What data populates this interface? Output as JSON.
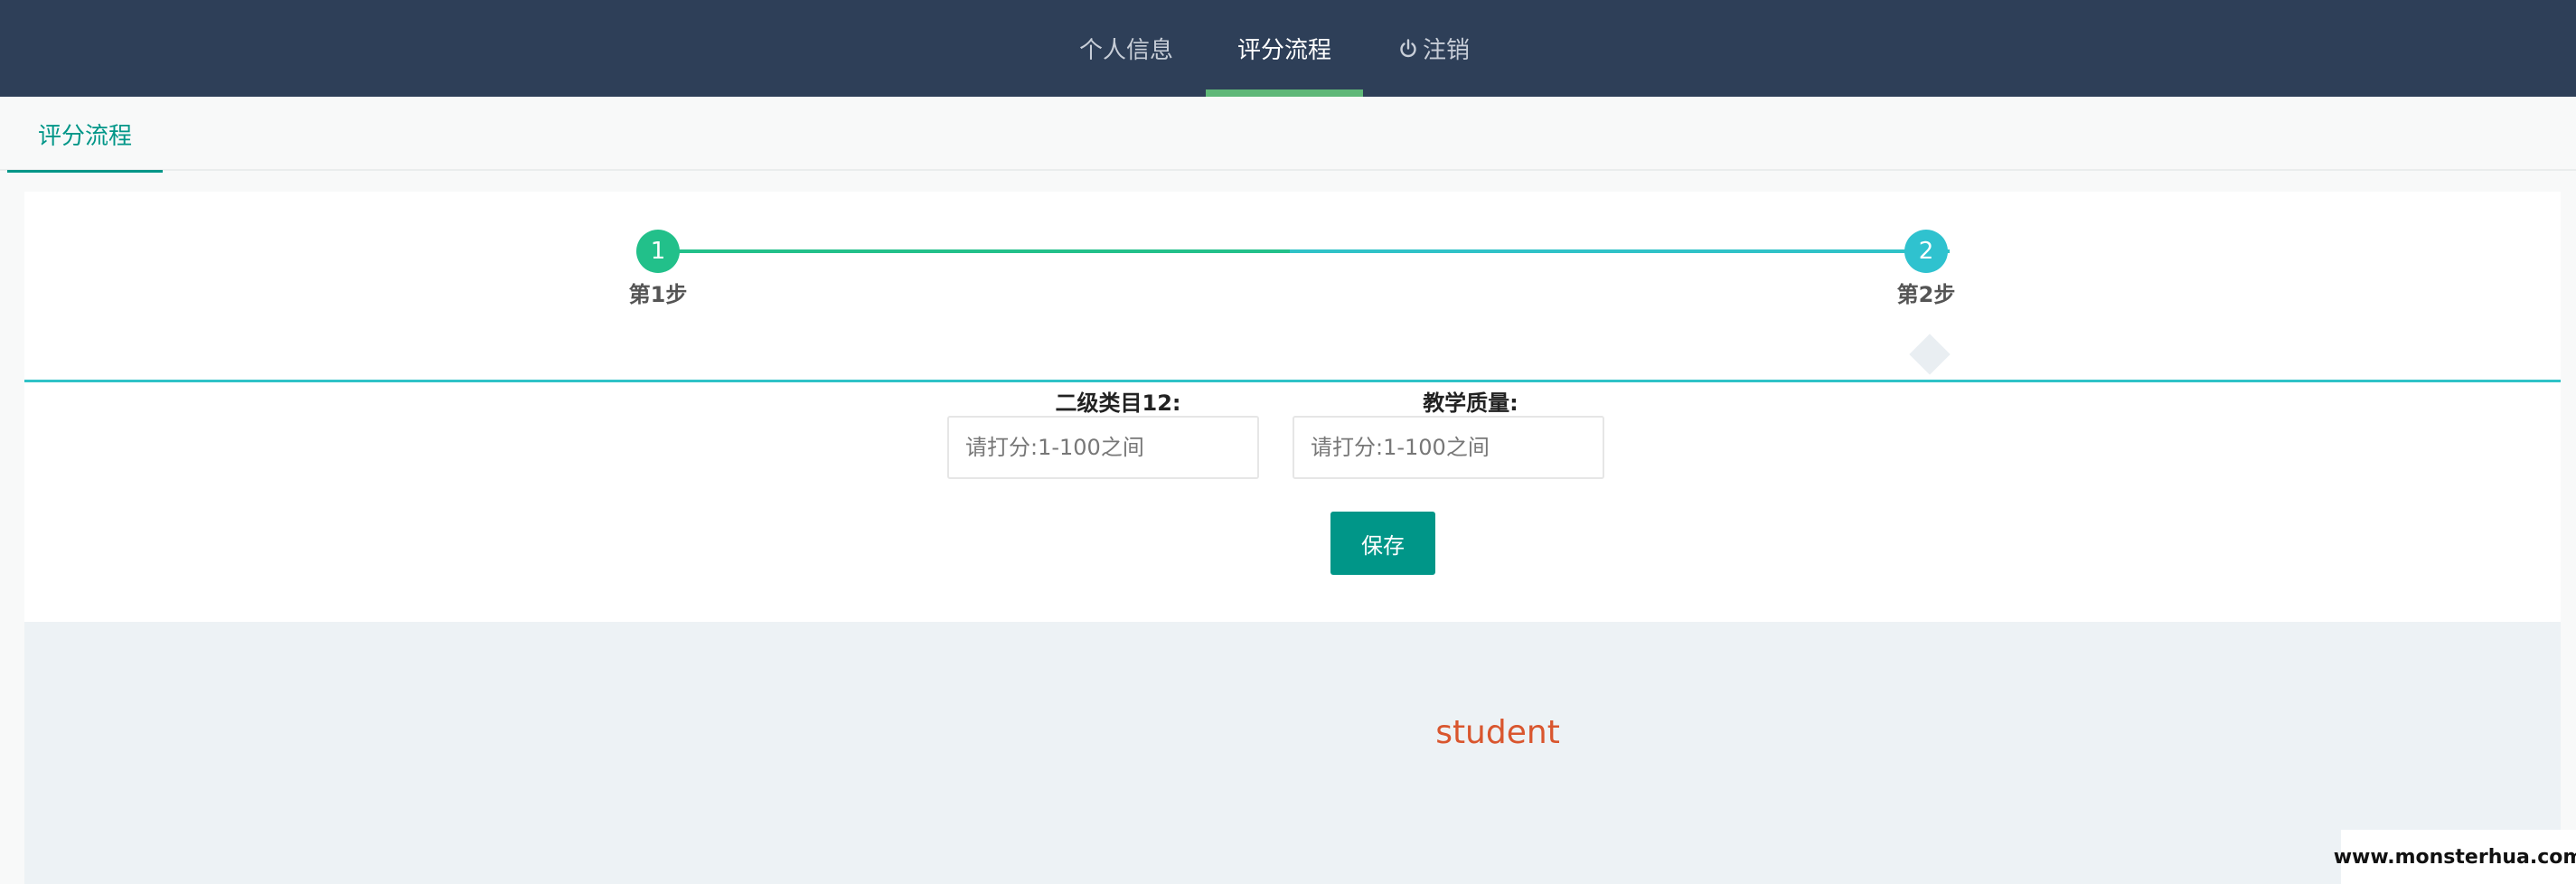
{
  "nav": {
    "items": [
      {
        "label": "个人信息",
        "active": false
      },
      {
        "label": "评分流程",
        "active": true
      },
      {
        "label": "注销",
        "icon": "power-icon",
        "active": false
      }
    ],
    "background": "#2e3f58",
    "active_indicator_color": "#5fb878"
  },
  "tabs": [
    {
      "label": "评分流程",
      "active": true
    }
  ],
  "steps": {
    "items": [
      {
        "number": "1",
        "label": "第1步",
        "color": "#22c08a"
      },
      {
        "number": "2",
        "label": "第2步",
        "color": "#2fc2cf"
      }
    ],
    "current": 2
  },
  "form": {
    "fields": [
      {
        "label": "二级类目12:",
        "placeholder": "请打分:1-100之间",
        "value": ""
      },
      {
        "label": "教学质量:",
        "placeholder": "请打分:1-100之间",
        "value": ""
      }
    ],
    "save_label": "保存",
    "accent": "#009688"
  },
  "footer": {
    "role": "student",
    "role_color": "#d9562e"
  },
  "watermark": "www.monsterhua.com"
}
